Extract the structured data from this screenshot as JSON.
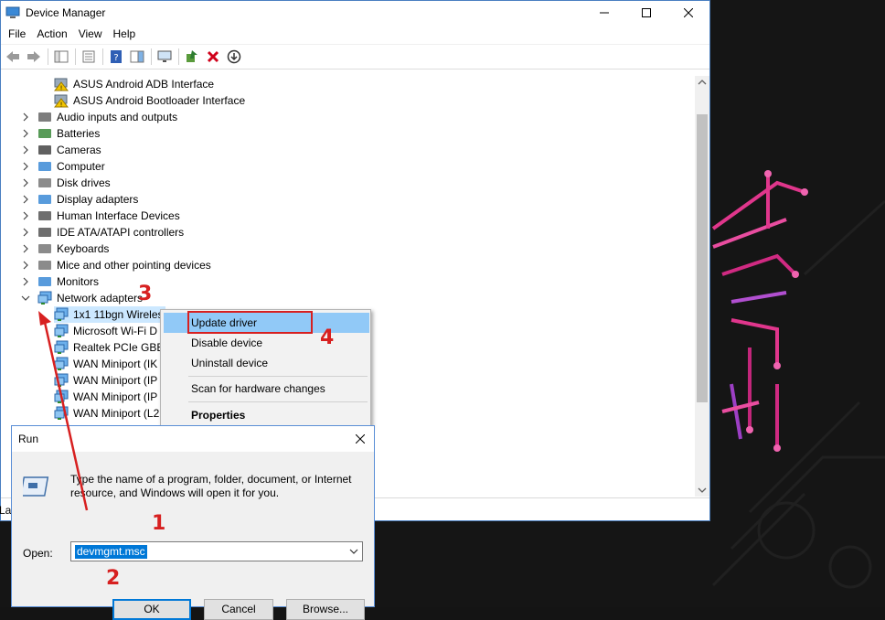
{
  "device_manager": {
    "title": "Device Manager",
    "menu": [
      "File",
      "Action",
      "View",
      "Help"
    ],
    "tree": [
      {
        "label": "ASUS Android ADB Interface",
        "level": 2,
        "icon": "warning-device-icon"
      },
      {
        "label": "ASUS Android Bootloader Interface",
        "level": 2,
        "icon": "warning-device-icon"
      },
      {
        "label": "Audio inputs and outputs",
        "level": 1,
        "icon": "speaker-icon",
        "expanded": false
      },
      {
        "label": "Batteries",
        "level": 1,
        "icon": "battery-icon",
        "expanded": false
      },
      {
        "label": "Cameras",
        "level": 1,
        "icon": "camera-icon",
        "expanded": false
      },
      {
        "label": "Computer",
        "level": 1,
        "icon": "computer-icon",
        "expanded": false
      },
      {
        "label": "Disk drives",
        "level": 1,
        "icon": "disk-icon",
        "expanded": false
      },
      {
        "label": "Display adapters",
        "level": 1,
        "icon": "display-adapter-icon",
        "expanded": false
      },
      {
        "label": "Human Interface Devices",
        "level": 1,
        "icon": "hid-icon",
        "expanded": false
      },
      {
        "label": "IDE ATA/ATAPI controllers",
        "level": 1,
        "icon": "ide-controller-icon",
        "expanded": false
      },
      {
        "label": "Keyboards",
        "level": 1,
        "icon": "keyboard-icon",
        "expanded": false
      },
      {
        "label": "Mice and other pointing devices",
        "level": 1,
        "icon": "mouse-icon",
        "expanded": false
      },
      {
        "label": "Monitors",
        "level": 1,
        "icon": "monitor-icon",
        "expanded": false
      },
      {
        "label": "Network adapters",
        "level": 1,
        "icon": "network-icon",
        "expanded": true
      },
      {
        "label": "1x1 11bgn Wireles",
        "level": 2,
        "icon": "network-icon",
        "selected": true
      },
      {
        "label": "Microsoft Wi-Fi D",
        "level": 2,
        "icon": "network-icon"
      },
      {
        "label": "Realtek PCIe GBE I",
        "level": 2,
        "icon": "network-icon"
      },
      {
        "label": "WAN Miniport (IK",
        "level": 2,
        "icon": "network-icon"
      },
      {
        "label": "WAN Miniport (IP",
        "level": 2,
        "icon": "network-icon"
      },
      {
        "label": "WAN Miniport (IP",
        "level": 2,
        "icon": "network-icon"
      },
      {
        "label": "WAN Miniport (L2",
        "level": 2,
        "icon": "network-icon"
      }
    ],
    "status_text": "La"
  },
  "context_menu": {
    "items": [
      "Update driver",
      "Disable device",
      "Uninstall device",
      "Scan for hardware changes",
      "Properties"
    ]
  },
  "run_dialog": {
    "title": "Run",
    "description": "Type the name of a program, folder, document, or Internet resource, and Windows will open it for you.",
    "open_label": "Open:",
    "open_value": "devmgmt.msc",
    "buttons": {
      "ok": "OK",
      "cancel": "Cancel",
      "browse": "Browse..."
    }
  },
  "annotations": [
    "1",
    "2",
    "3",
    "4"
  ],
  "colors": {
    "accent": "#0078d7",
    "annotation": "#d72020",
    "menu_highlight": "#91c9f7"
  }
}
